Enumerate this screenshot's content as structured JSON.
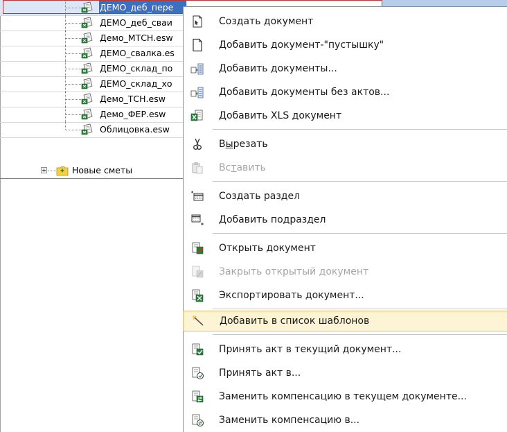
{
  "tree": {
    "items": [
      {
        "label": "ДЕМО_деб_пере",
        "selected": true
      },
      {
        "label": "ДЕМО_деб_сваи"
      },
      {
        "label": "Демо_МТСН.esw"
      },
      {
        "label": "ДЕМО_свалка.es"
      },
      {
        "label": "ДЕМО_склад_по"
      },
      {
        "label": "ДЕМО_склад_хо"
      },
      {
        "label": "Демо_ТСН.esw"
      },
      {
        "label": "Демо_ФЕР.esw"
      },
      {
        "label": "Облицовка.esw"
      }
    ],
    "group": {
      "label": "Новые сметы"
    }
  },
  "menu": {
    "items": [
      {
        "label": "Создать документ",
        "icon": "new-document-icon",
        "enabled": true
      },
      {
        "label": "Добавить документ-\"пустышку\"",
        "icon": "blank-document-icon",
        "enabled": true
      },
      {
        "label": "Добавить документы...",
        "icon": "add-documents-icon",
        "enabled": true
      },
      {
        "label": "Добавить документы без актов...",
        "icon": "add-documents-no-acts-icon",
        "enabled": true
      },
      {
        "label": "Добавить XLS документ",
        "icon": "excel-document-icon",
        "enabled": true
      },
      {
        "label_pre": "В",
        "label_accel": "ы",
        "label_post": "резать",
        "icon": "scissors-icon",
        "enabled": true
      },
      {
        "label_pre": "Вс",
        "label_accel": "т",
        "label_post": "авить",
        "icon": "clipboard-icon",
        "enabled": false
      },
      {
        "label": "Создать раздел",
        "icon": "create-section-icon",
        "enabled": true
      },
      {
        "label": "Добавить подраздел",
        "icon": "add-subsection-icon",
        "enabled": true
      },
      {
        "label": "Открыть документ",
        "icon": "open-document-icon",
        "enabled": true
      },
      {
        "label": "Закрыть открытый документ",
        "icon": "close-document-icon",
        "enabled": false
      },
      {
        "label": "Экспортировать документ...",
        "icon": "export-document-icon",
        "enabled": true
      },
      {
        "label": "Добавить в список шаблонов",
        "icon": "magic-wand-icon",
        "enabled": true,
        "highlighted": true
      },
      {
        "label": "Принять акт в текущий документ...",
        "icon": "accept-act-current-icon",
        "enabled": true
      },
      {
        "label": "Принять акт в...",
        "icon": "accept-act-icon",
        "enabled": true
      },
      {
        "label": "Заменить компенсацию в текущем документе...",
        "icon": "replace-compensation-current-icon",
        "enabled": true
      },
      {
        "label": "Заменить компенсацию в...",
        "icon": "replace-compensation-icon",
        "enabled": true
      }
    ]
  },
  "colors": {
    "selection": "#3d6fc0",
    "highlight_fill": "#fdf4d5",
    "highlight_border": "#e3be5c",
    "disabled_text": "#a6a6a6"
  }
}
